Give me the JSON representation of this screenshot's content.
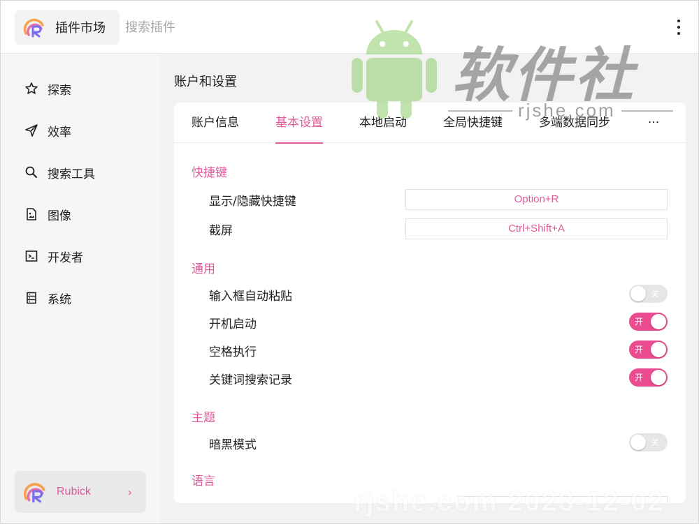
{
  "header": {
    "brand_title": "插件市场",
    "search_placeholder": "搜索插件"
  },
  "sidebar": {
    "items": [
      {
        "label": "探索",
        "icon": "star-icon"
      },
      {
        "label": "效率",
        "icon": "send-icon"
      },
      {
        "label": "搜索工具",
        "icon": "search-icon"
      },
      {
        "label": "图像",
        "icon": "image-file-icon"
      },
      {
        "label": "开发者",
        "icon": "terminal-icon"
      },
      {
        "label": "系统",
        "icon": "system-icon"
      }
    ],
    "user": {
      "name": "Rubick",
      "chevron": "›"
    }
  },
  "main": {
    "page_title": "账户和设置",
    "tabs": [
      {
        "label": "账户信息",
        "active": false
      },
      {
        "label": "基本设置",
        "active": true
      },
      {
        "label": "本地启动",
        "active": false
      },
      {
        "label": "全局快捷键",
        "active": false
      },
      {
        "label": "多端数据同步",
        "active": false
      },
      {
        "label": "···",
        "active": false
      }
    ],
    "sections": {
      "shortcut": {
        "title": "快捷键",
        "rows": [
          {
            "label": "显示/隐藏快捷键",
            "value": "Option+R"
          },
          {
            "label": "截屏",
            "value": "Ctrl+Shift+A"
          }
        ]
      },
      "general": {
        "title": "通用",
        "rows": [
          {
            "label": "输入框自动粘贴",
            "state": "off",
            "text": "关"
          },
          {
            "label": "开机启动",
            "state": "on",
            "text": "开"
          },
          {
            "label": "空格执行",
            "state": "on",
            "text": "开"
          },
          {
            "label": "关键词搜索记录",
            "state": "on",
            "text": "开"
          }
        ]
      },
      "theme": {
        "title": "主题",
        "rows": [
          {
            "label": "暗黑模式",
            "state": "off",
            "text": "关"
          }
        ]
      },
      "language": {
        "title": "语言"
      }
    }
  },
  "watermark": {
    "site_name": "软件社",
    "domain": "rjshe.com",
    "bottom_text": "rjshe.com 2023-12-02"
  },
  "colors": {
    "accent": "#e05a9a",
    "toggle_on": "#ea4c8f",
    "toggle_off": "#e6e6e6",
    "sidebar_bg": "#f6f6f6",
    "main_bg": "#f2f2f2"
  }
}
